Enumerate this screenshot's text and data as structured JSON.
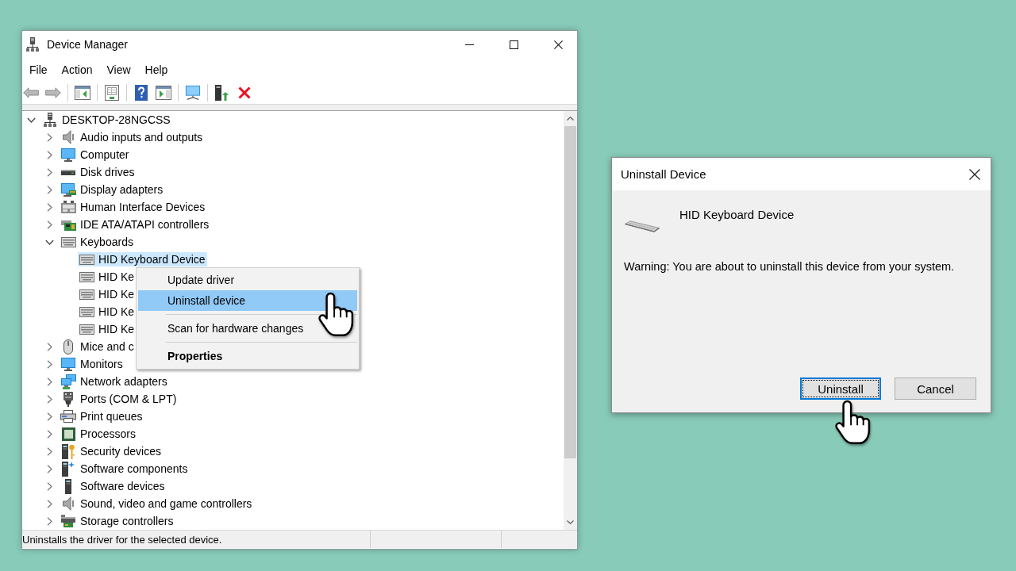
{
  "window": {
    "title": "Device Manager"
  },
  "menu": [
    "File",
    "Action",
    "View",
    "Help"
  ],
  "tree": [
    {
      "label": "DESKTOP-28NGCSS",
      "kind": "host",
      "expanded": true,
      "selected": false,
      "children": [
        {
          "label": "Audio inputs and outputs",
          "kind": "audio",
          "expanded": false,
          "selected": false
        },
        {
          "label": "Computer",
          "kind": "computer",
          "expanded": false,
          "selected": false
        },
        {
          "label": "Disk drives",
          "kind": "disk",
          "expanded": false,
          "selected": false
        },
        {
          "label": "Display adapters",
          "kind": "display",
          "expanded": false,
          "selected": false
        },
        {
          "label": "Human Interface Devices",
          "kind": "hid",
          "expanded": false,
          "selected": false
        },
        {
          "label": "IDE ATA/ATAPI controllers",
          "kind": "ide",
          "expanded": false,
          "selected": false
        },
        {
          "label": "Keyboards",
          "kind": "keyboard",
          "expanded": true,
          "selected": false,
          "children": [
            {
              "label": "HID Keyboard Device",
              "kind": "keyboard",
              "selected": true
            },
            {
              "label": "HID Ke",
              "kind": "keyboard",
              "selected": false
            },
            {
              "label": "HID Ke",
              "kind": "keyboard",
              "selected": false
            },
            {
              "label": "HID Ke",
              "kind": "keyboard",
              "selected": false
            },
            {
              "label": "HID Ke",
              "kind": "keyboard",
              "selected": false
            }
          ]
        },
        {
          "label": "Mice and c",
          "kind": "mouse",
          "expanded": false,
          "selected": false
        },
        {
          "label": "Monitors",
          "kind": "monitor",
          "expanded": false,
          "selected": false
        },
        {
          "label": "Network adapters",
          "kind": "network",
          "expanded": false,
          "selected": false
        },
        {
          "label": "Ports (COM & LPT)",
          "kind": "port",
          "expanded": false,
          "selected": false
        },
        {
          "label": "Print queues",
          "kind": "printer",
          "expanded": false,
          "selected": false
        },
        {
          "label": "Processors",
          "kind": "processor",
          "expanded": false,
          "selected": false
        },
        {
          "label": "Security devices",
          "kind": "security",
          "expanded": false,
          "selected": false
        },
        {
          "label": "Software components",
          "kind": "component",
          "expanded": false,
          "selected": false
        },
        {
          "label": "Software devices",
          "kind": "software",
          "expanded": false,
          "selected": false
        },
        {
          "label": "Sound, video and game controllers",
          "kind": "sound",
          "expanded": false,
          "selected": false
        },
        {
          "label": "Storage controllers",
          "kind": "storage",
          "expanded": false,
          "selected": false
        }
      ]
    }
  ],
  "context_menu": {
    "groups": [
      {
        "items": [
          {
            "label": "Update driver",
            "selected": false,
            "default": false
          },
          {
            "label": "Uninstall device",
            "selected": true,
            "default": false
          }
        ]
      },
      {
        "items": [
          {
            "label": "Scan for hardware changes",
            "selected": false,
            "default": false
          }
        ]
      },
      {
        "items": [
          {
            "label": "Properties",
            "selected": false,
            "default": true
          }
        ]
      }
    ]
  },
  "status_bar": {
    "text": "Uninstalls the driver for the selected device."
  },
  "dialog": {
    "title": "Uninstall Device",
    "device_name": "HID Keyboard Device",
    "message": "Warning: You are about to uninstall this device from your system.",
    "buttons": [
      {
        "label": "Uninstall",
        "default": true
      },
      {
        "label": "Cancel",
        "default": false
      }
    ]
  }
}
